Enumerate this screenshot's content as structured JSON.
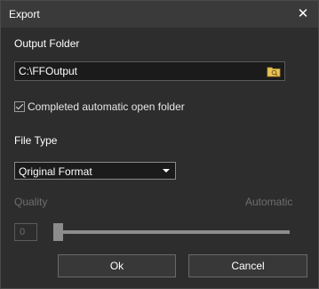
{
  "window": {
    "title": "Export",
    "close_icon": "close-icon"
  },
  "output_folder": {
    "label": "Output Folder",
    "value": "C:\\FFOutput",
    "browse_icon": "folder-icon"
  },
  "auto_open": {
    "label": "Completed automatic open folder",
    "checked": true
  },
  "file_type": {
    "label": "File Type",
    "selected": "Qriginal Format"
  },
  "quality": {
    "label": "Quality",
    "mode_label": "Automatic",
    "value": "0",
    "slider_level": 0,
    "enabled": false
  },
  "buttons": {
    "ok": "Ok",
    "cancel": "Cancel"
  },
  "colors": {
    "background": "#2d2d2d",
    "titlebar": "#3a3a3a",
    "disabled_text": "#6e6e6e",
    "folder_icon": "#e8c35a"
  }
}
